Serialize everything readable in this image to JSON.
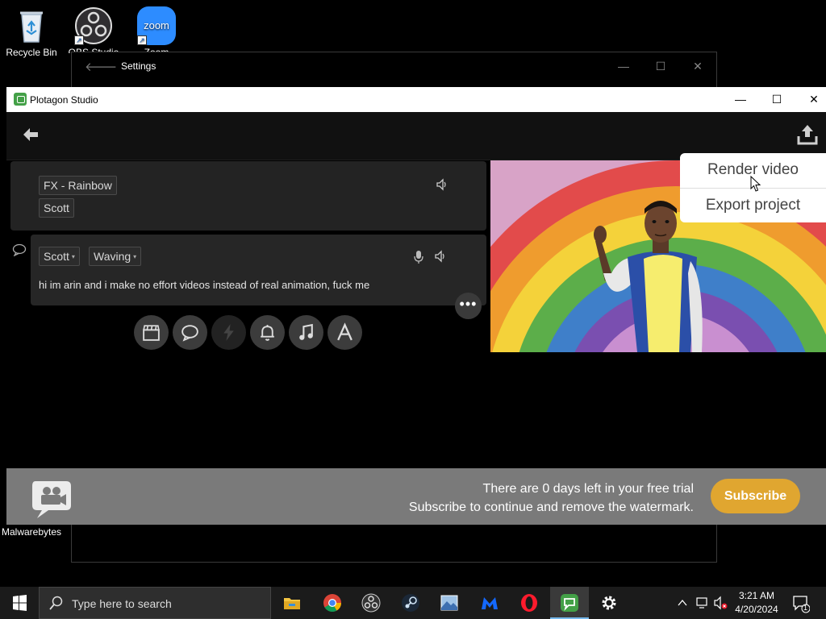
{
  "desktop": {
    "icons": [
      {
        "label": "Recycle Bin",
        "icon": "recycle-bin-icon"
      },
      {
        "label": "OBS Studio",
        "icon": "obs-studio-icon"
      },
      {
        "label": "Zoom",
        "icon": "zoom-icon",
        "logo_text": "zoom"
      }
    ]
  },
  "settings_window": {
    "title": "Settings",
    "back_icon": "arrow-left-icon",
    "controls": {
      "minimize": "—",
      "maximize": "☐",
      "close": "✕"
    }
  },
  "plotagon": {
    "title": "Plotagon Studio",
    "controls": {
      "minimize": "—",
      "maximize": "☐",
      "close": "✕"
    },
    "toolbar": {
      "back": "🡸",
      "share_icon": "share-upload-icon"
    },
    "scene": {
      "fx": "FX - Rainbow",
      "character": "Scott"
    },
    "line": {
      "character": "Scott",
      "action": "Waving",
      "dropdown_glyph": "▾",
      "text": "hi im arin and i make no effort videos instead of real animation, fuck me"
    },
    "more_label": "•••",
    "add_buttons": [
      {
        "icon": "clapperboard-icon",
        "enabled": true
      },
      {
        "icon": "speech-bubble-icon",
        "enabled": true
      },
      {
        "icon": "lightning-icon",
        "enabled": false
      },
      {
        "icon": "bell-icon",
        "enabled": true
      },
      {
        "icon": "music-note-icon",
        "enabled": true
      },
      {
        "icon": "text-a-icon",
        "enabled": true
      }
    ],
    "export_menu": {
      "items": [
        "Render video",
        "Export project"
      ]
    },
    "trial": {
      "line1": "There are 0 days left in your free trial",
      "line2": "Subscribe to continue and remove the watermark.",
      "subscribe": "Subscribe"
    }
  },
  "desktop_label_malwarebytes": "Malwarebytes",
  "taskbar": {
    "search_placeholder": "Type here to search",
    "apps": [
      "file-explorer-icon",
      "chrome-icon",
      "obs-icon",
      "steam-icon",
      "image-viewer-icon",
      "malwarebytes-icon",
      "opera-icon",
      "plotagon-icon",
      "settings-gear-icon"
    ],
    "time": "3:21 AM",
    "date": "4/20/2024",
    "notification_count": "1",
    "colors": {
      "accent": "#76b9ed",
      "subscribe": "#e0a630",
      "plotagon_green": "#43a047"
    }
  }
}
